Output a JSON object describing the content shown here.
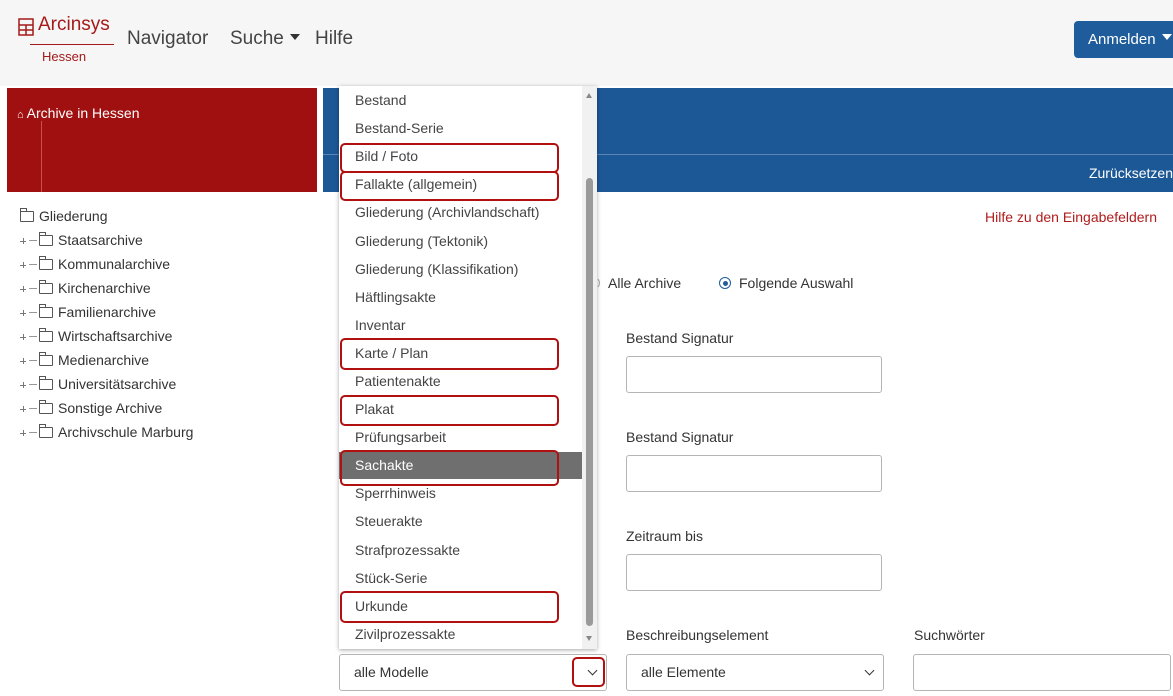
{
  "brand": {
    "name": "Arcinsys",
    "region": "Hessen"
  },
  "nav": {
    "navigator": "Navigator",
    "search": "Suche",
    "help": "Hilfe"
  },
  "login_label": "Anmelden",
  "sidebar": {
    "title": "Archive in Hessen",
    "tree_root": "Gliederung",
    "tree_items": [
      "Staatsarchive",
      "Kommunalarchive",
      "Kirchenarchive",
      "Familienarchive",
      "Wirtschaftsarchive",
      "Medienarchive",
      "Universitätsarchive",
      "Sonstige Archive",
      "Archivschule Marburg"
    ]
  },
  "main": {
    "reset_label": "Zurücksetzen",
    "help_fields_label": "Hilfe zu den Eingabefeldern",
    "radio_all": "Alle Archive",
    "radio_selection": "Folgende Auswahl",
    "label_bestand_signatur_1": "Bestand Signatur",
    "label_bestand_signatur_2": "Bestand Signatur",
    "label_zeitraum_bis": "Zeitraum bis",
    "label_beschreibungselement": "Beschreibungselement",
    "label_suchwoerter": "Suchwörter",
    "select_modell_value": "alle Modelle",
    "select_element_value": "alle Elemente"
  },
  "dropdown": {
    "options": [
      "Bestand",
      "Bestand-Serie",
      "Bild / Foto",
      "Fallakte (allgemein)",
      "Gliederung (Archivlandschaft)",
      "Gliederung (Tektonik)",
      "Gliederung (Klassifikation)",
      "Häftlingsakte",
      "Inventar",
      "Karte / Plan",
      "Patientenakte",
      "Plakat",
      "Prüfungsarbeit",
      "Sachakte",
      "Sperrhinweis",
      "Steuerakte",
      "Strafprozessakte",
      "Stück-Serie",
      "Urkunde",
      "Zivilprozessakte"
    ],
    "selected": "Sachakte",
    "highlighted": [
      "Bild / Foto",
      "Fallakte (allgemein)",
      "Karte / Plan",
      "Plakat",
      "Sachakte",
      "Urkunde"
    ]
  },
  "colors": {
    "brand_red": "#a01010",
    "primary_blue": "#1d5896",
    "highlight_border": "#b01010"
  }
}
